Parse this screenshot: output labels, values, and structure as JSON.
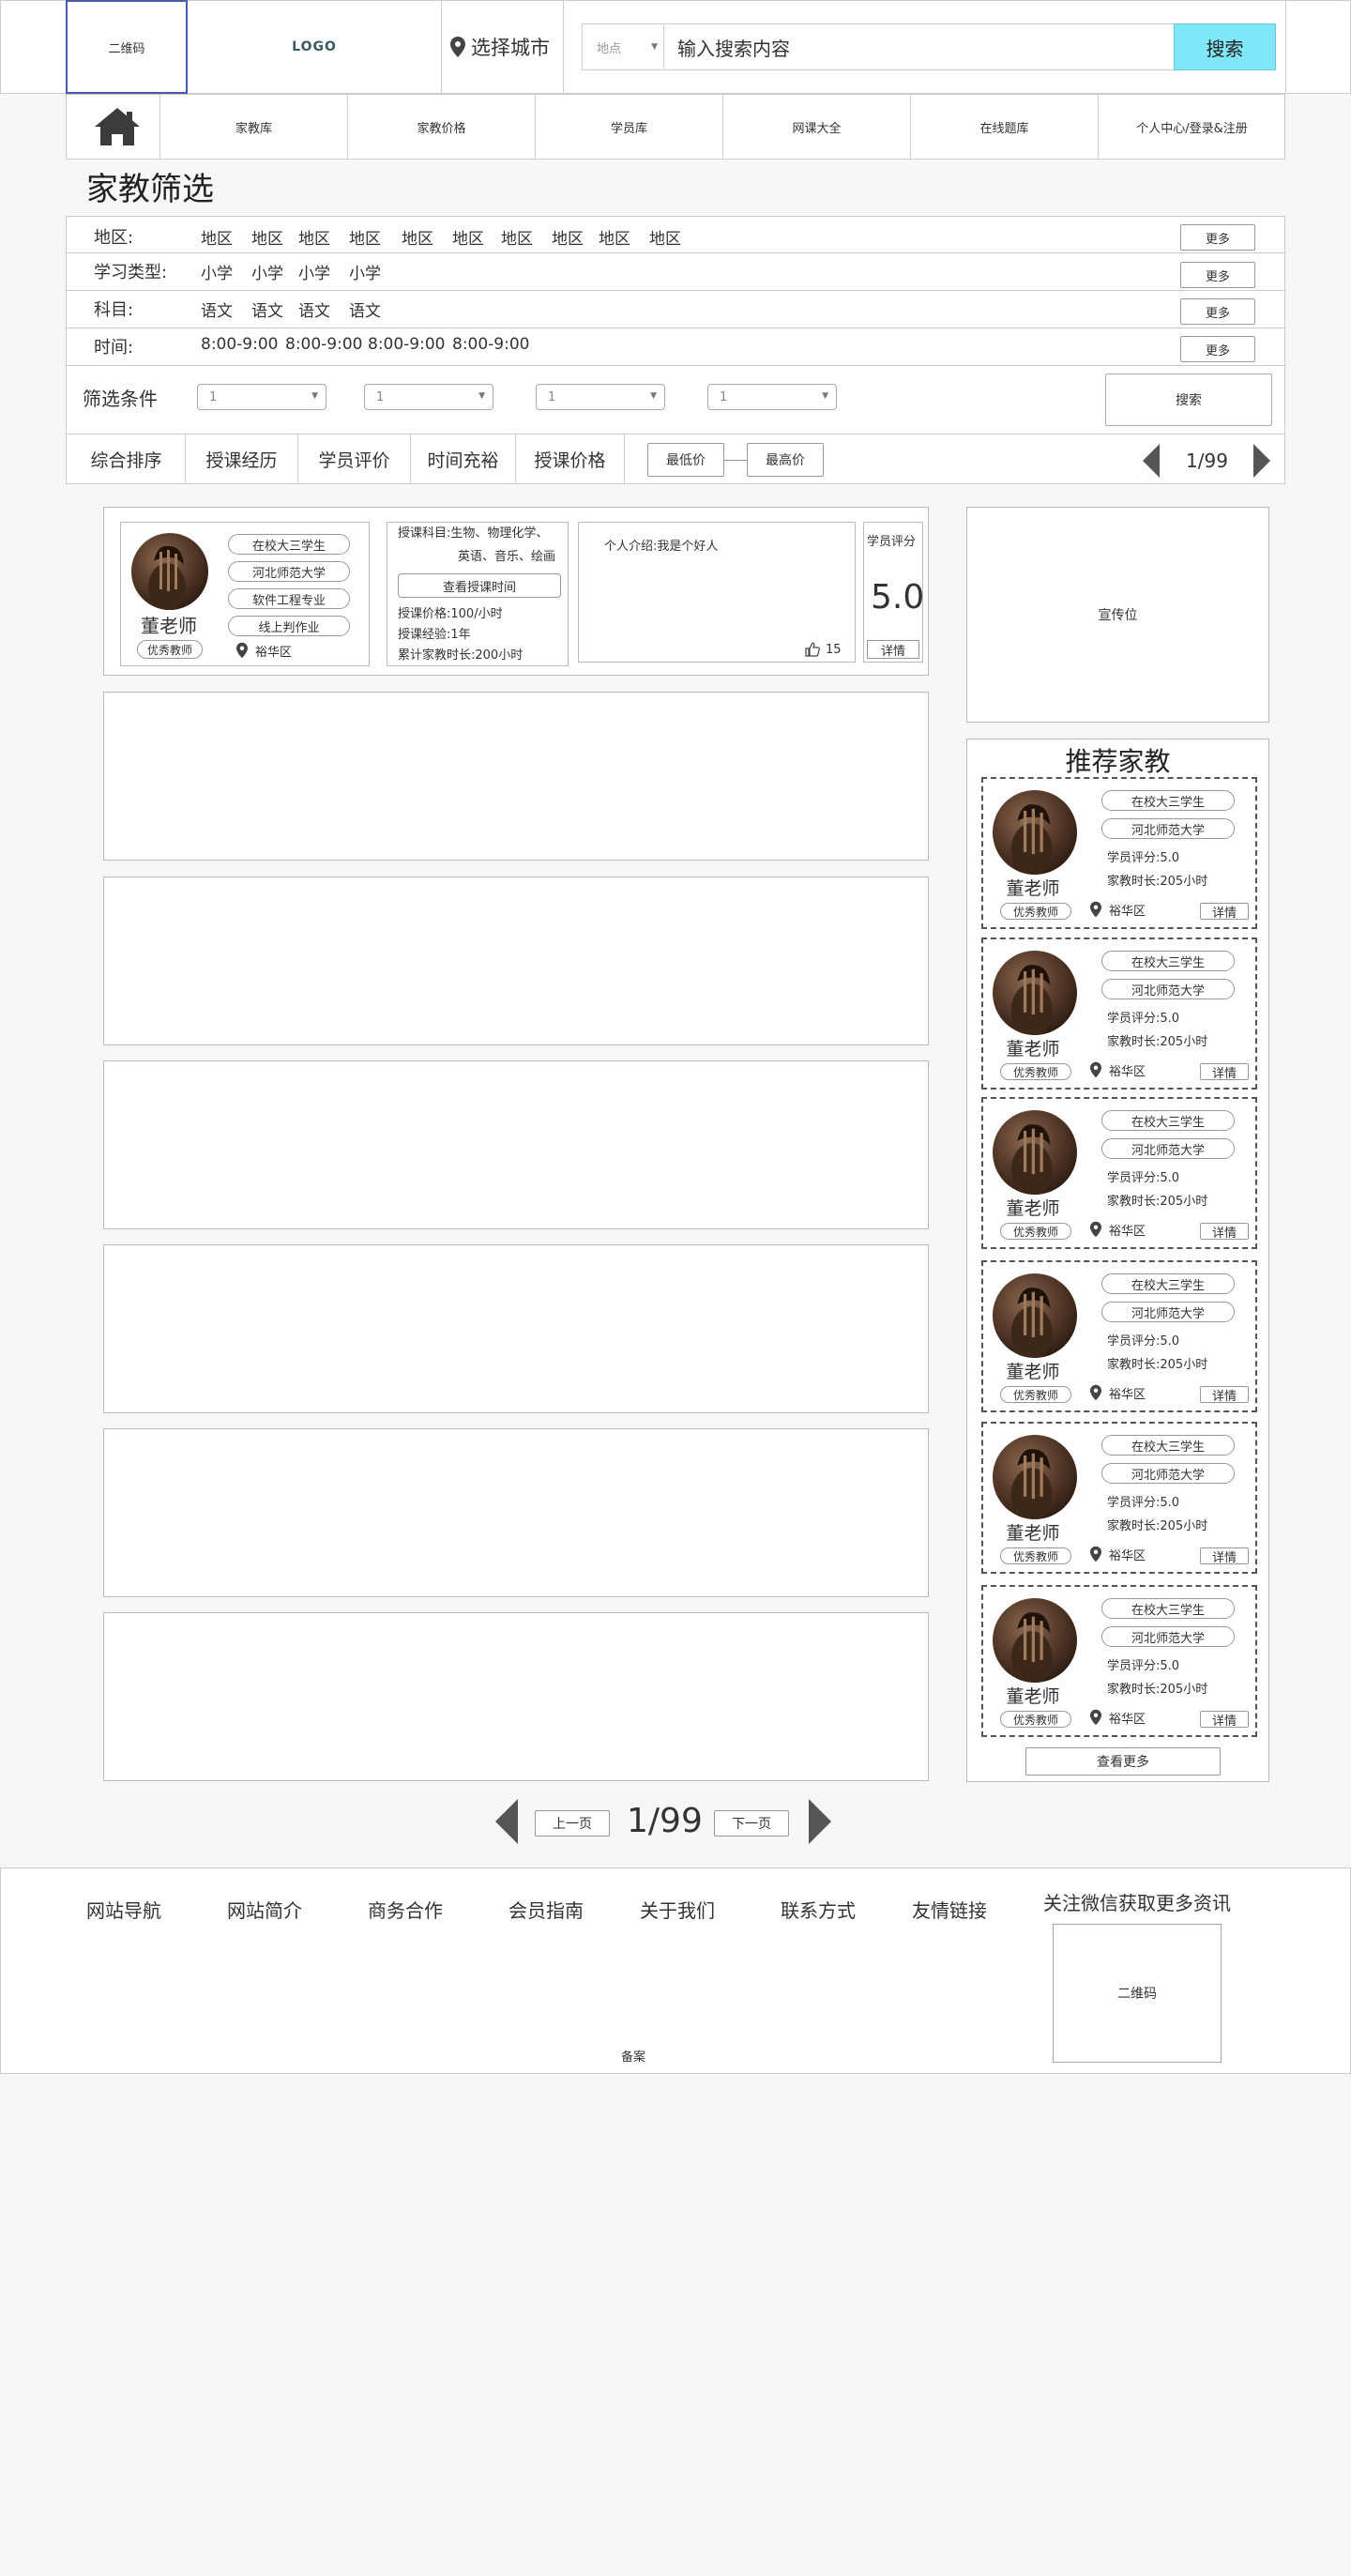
{
  "header": {
    "qr_label": "二维码",
    "logo": "LOGO",
    "city_label": "选择城市",
    "location_select": "地点",
    "search_placeholder": "输入搜索内容",
    "search_button": "搜索"
  },
  "nav": {
    "items": [
      {
        "label": "家教库"
      },
      {
        "label": "家教价格"
      },
      {
        "label": "学员库"
      },
      {
        "label": "网课大全"
      },
      {
        "label": "在线题库"
      },
      {
        "label": "个人中心/登录&注册"
      }
    ]
  },
  "filter": {
    "title": "家教筛选",
    "rows": [
      {
        "label": "地区:",
        "values": [
          "地区",
          "地区",
          "地区",
          "地区",
          "地区",
          "地区",
          "地区",
          "地区",
          "地区",
          "地区"
        ],
        "more": "更多"
      },
      {
        "label": "学习类型:",
        "values": [
          "小学",
          "小学",
          "小学",
          "小学"
        ],
        "more": "更多"
      },
      {
        "label": "科目:",
        "values": [
          "语文",
          "语文",
          "语文",
          "语文"
        ],
        "more": "更多"
      },
      {
        "label": "时间:",
        "values": [
          "8:00-9:00",
          "8:00-9:00",
          "8:00-9:00",
          "8:00-9:00"
        ],
        "more": "更多"
      }
    ],
    "condition_label": "筛选条件",
    "dropdowns": [
      "1",
      "1",
      "1",
      "1"
    ],
    "search_button": "搜索"
  },
  "sort": {
    "tabs": [
      "综合排序",
      "授课经历",
      "学员评价",
      "时间充裕",
      "授课价格"
    ],
    "min_price": "最低价",
    "max_price": "最高价",
    "page": "1/99"
  },
  "teacher_card": {
    "name": "董老师",
    "badge": "优秀教师",
    "tags": [
      "在校大三学生",
      "河北师范大学",
      "软件工程专业",
      "线上判作业"
    ],
    "district": "裕华区",
    "subjects_line1": "授课科目:生物、物理化学、",
    "subjects_line2": "英语、音乐、绘画",
    "view_time_button": "查看授课时间",
    "price": "授课价格:100/小时",
    "experience": "授课经验:1年",
    "total_hours": "累计家教时长:200小时",
    "intro": "个人介绍:我是个好人",
    "likes": "15",
    "rating_label": "学员评分",
    "rating": "5.0",
    "detail_button": "详情"
  },
  "sidebar": {
    "ad_label": "宣传位",
    "rec_title": "推荐家教",
    "rec_items": [
      {
        "name": "董老师",
        "badge": "优秀教师",
        "tag1": "在校大三学生",
        "tag2": "河北师范大学",
        "rating": "学员评分:5.0",
        "hours": "家教时长:205小时",
        "district": "裕华区",
        "detail": "详情"
      },
      {
        "name": "董老师",
        "badge": "优秀教师",
        "tag1": "在校大三学生",
        "tag2": "河北师范大学",
        "rating": "学员评分:5.0",
        "hours": "家教时长:205小时",
        "district": "裕华区",
        "detail": "详情"
      },
      {
        "name": "董老师",
        "badge": "优秀教师",
        "tag1": "在校大三学生",
        "tag2": "河北师范大学",
        "rating": "学员评分:5.0",
        "hours": "家教时长:205小时",
        "district": "裕华区",
        "detail": "详情"
      },
      {
        "name": "董老师",
        "badge": "优秀教师",
        "tag1": "在校大三学生",
        "tag2": "河北师范大学",
        "rating": "学员评分:5.0",
        "hours": "家教时长:205小时",
        "district": "裕华区",
        "detail": "详情"
      },
      {
        "name": "董老师",
        "badge": "优秀教师",
        "tag1": "在校大三学生",
        "tag2": "河北师范大学",
        "rating": "学员评分:5.0",
        "hours": "家教时长:205小时",
        "district": "裕华区",
        "detail": "详情"
      },
      {
        "name": "董老师",
        "badge": "优秀教师",
        "tag1": "在校大三学生",
        "tag2": "河北师范大学",
        "rating": "学员评分:5.0",
        "hours": "家教时长:205小时",
        "district": "裕华区",
        "detail": "详情"
      }
    ],
    "see_more": "查看更多"
  },
  "pager": {
    "prev": "上一页",
    "page": "1/99",
    "next": "下一页"
  },
  "footer": {
    "links": [
      "网站导航",
      "网站简介",
      "商务合作",
      "会员指南",
      "关于我们",
      "联系方式",
      "友情链接"
    ],
    "wechat_label": "关注微信获取更多资讯",
    "qr_label": "二维码",
    "record": "备案"
  },
  "colors": {
    "search_button_bg": "#7fe7f7",
    "qr_border": "#4a5ba8",
    "background": "#f7f7f7"
  }
}
